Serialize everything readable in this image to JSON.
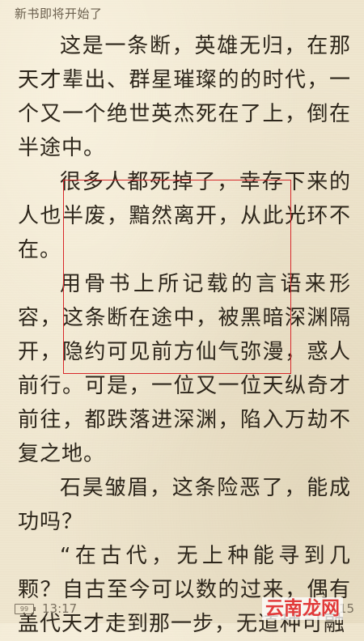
{
  "header": {
    "title": "新书即将开始了"
  },
  "content": {
    "paragraphs": [
      {
        "text": "这是一条断，英雄无归，在那天才辈出、群星璀璨的的时代，一个又一个绝世英杰死在了上，倒在半途中。",
        "indent": true
      },
      {
        "text": "很多人都死掉了，幸存下来的人也半废，黯然离开，从此光环不在。",
        "indent": true
      },
      {
        "text": "用骨书上所记载的言语来形容，这条断在途中，被黑暗深渊隔开，隐约可见前方仙气弥漫，惑人前行。可是，一位又一位天纵奇才前往，都跌落进深渊，陷入万劫不复之地。",
        "indent": true
      },
      {
        "text": "石昊皱眉，这条险恶了，能成功吗？",
        "indent": true
      },
      {
        "text": "“在古代，无上种能寻到几颗？自古至今可以数的过来，偶有盖代天才走到那一步，无道种可融",
        "indent": true
      }
    ]
  },
  "status": {
    "battery": "99",
    "time": "13:17",
    "page": "/15"
  },
  "watermark": {
    "text": "云南龙网"
  },
  "colors": {
    "selection_border": "#d8282a",
    "page_background": "#efe6cf"
  },
  "icons": {
    "battery": "battery-icon"
  }
}
